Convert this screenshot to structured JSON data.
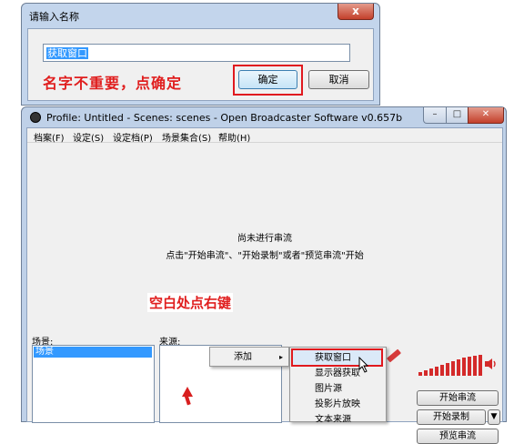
{
  "dialog": {
    "title": "请输入名称",
    "close_glyph": "x",
    "input_value": "获取窗口",
    "hint": "名字不重要，点确定",
    "ok_label": "确定",
    "cancel_label": "取消"
  },
  "obs": {
    "title": "Profile: Untitled - Scenes: scenes - Open Broadcaster Software v0.657b",
    "window_buttons": {
      "minimize": "–",
      "maximize": "□",
      "close": "✕"
    },
    "menu": [
      "档案(F)",
      "设定(S)",
      "设定档(P)",
      "场景集合(S)",
      "帮助(H)"
    ],
    "status_line1": "尚未进行串流",
    "status_line2": "点击\"开始串流\"、\"开始录制\"或者\"预览串流\"开始",
    "scenes_label": "场景:",
    "sources_label": "来源:",
    "scene_items": [
      "场景"
    ],
    "blank_hint": "空白处点右键",
    "buttons": {
      "start_stream": "开始串流",
      "start_record": "开始录制",
      "record_dropdown": "▼",
      "preview_stream": "预览串流"
    }
  },
  "context_menu": {
    "add_label": "添加",
    "submenu_arrow": "▸",
    "items": [
      "获取窗口",
      "显示器获取",
      "图片源",
      "投影片放映",
      "文本来源"
    ]
  },
  "colors": {
    "annotation_red": "#e01e1e",
    "selection_blue": "#3399ff",
    "window_frame": "#c3d5ec"
  }
}
